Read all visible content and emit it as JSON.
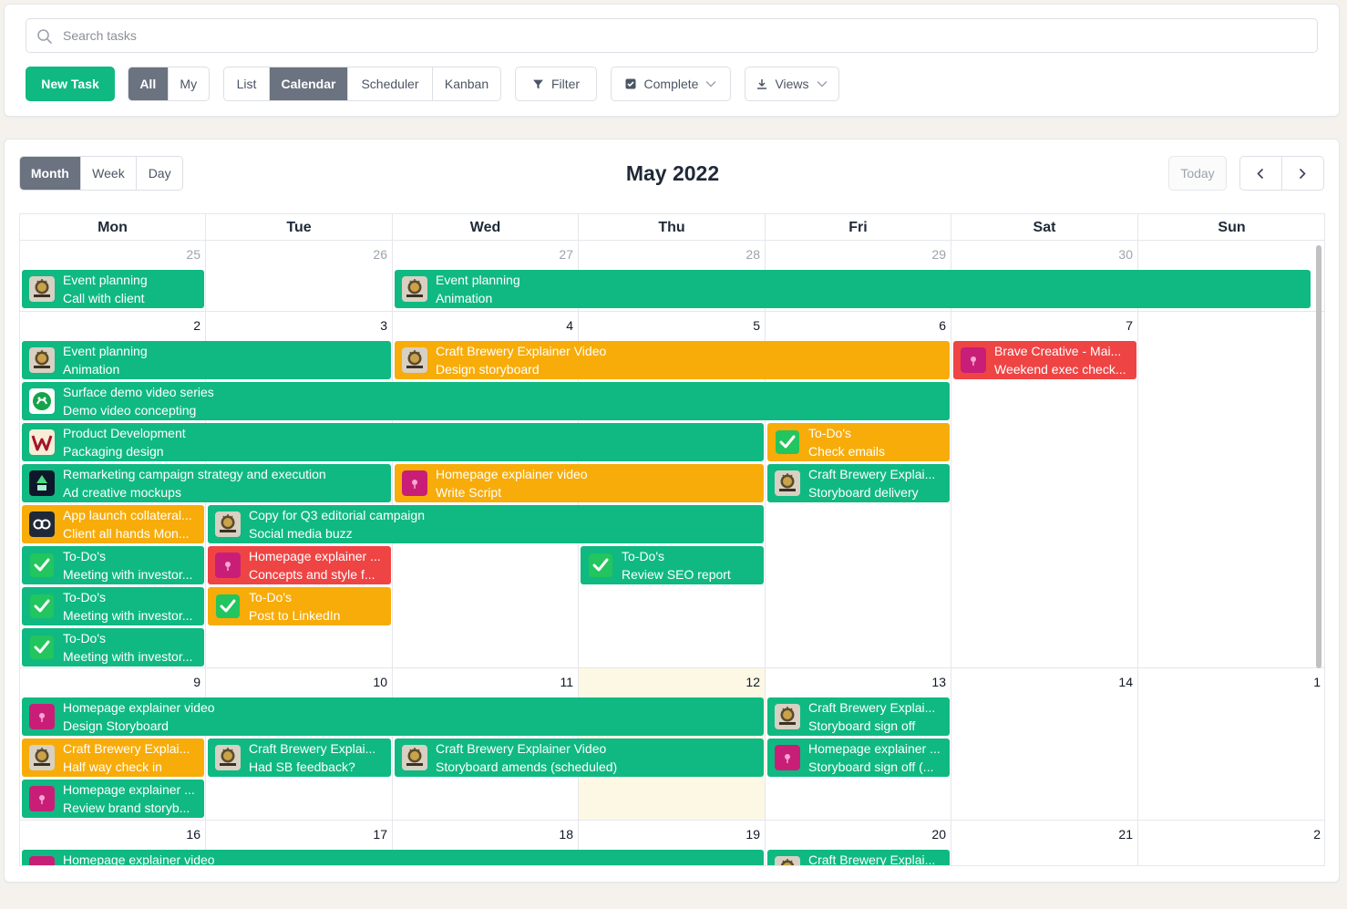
{
  "search": {
    "placeholder": "Search tasks",
    "value": ""
  },
  "toolbar": {
    "new_task": "New Task",
    "scope": [
      {
        "label": "All",
        "active": true
      },
      {
        "label": "My",
        "active": false
      }
    ],
    "views": [
      {
        "label": "List",
        "active": false
      },
      {
        "label": "Calendar",
        "active": true
      },
      {
        "label": "Scheduler",
        "active": false
      },
      {
        "label": "Kanban",
        "active": false
      }
    ],
    "filter": "Filter",
    "complete": "Complete",
    "views_menu": "Views"
  },
  "calendar": {
    "title": "May 2022",
    "range_tabs": [
      {
        "label": "Month",
        "active": true
      },
      {
        "label": "Week",
        "active": false
      },
      {
        "label": "Day",
        "active": false
      }
    ],
    "today": "Today",
    "weekdays": [
      "Mon",
      "Tue",
      "Wed",
      "Thu",
      "Fri",
      "Sat",
      "Sun"
    ],
    "weeks": [
      {
        "days": [
          {
            "n": "25",
            "other": true
          },
          {
            "n": "26",
            "other": true
          },
          {
            "n": "27",
            "other": true
          },
          {
            "n": "28",
            "other": true
          },
          {
            "n": "29",
            "other": true
          },
          {
            "n": "30",
            "other": true
          },
          {
            "n": "",
            "other": true
          }
        ],
        "events": [
          {
            "col": 0,
            "span": 1,
            "row": 0,
            "color": "green",
            "icon": "brewery",
            "t1": "Event planning",
            "t2": "Call with client"
          },
          {
            "col": 2,
            "span": 5,
            "row": 0,
            "color": "green",
            "icon": "brewery",
            "t1": "Event planning",
            "t2": "Animation"
          }
        ]
      },
      {
        "days": [
          {
            "n": "2"
          },
          {
            "n": "3"
          },
          {
            "n": "4"
          },
          {
            "n": "5"
          },
          {
            "n": "6"
          },
          {
            "n": "7"
          },
          {
            "n": ""
          }
        ],
        "events": [
          {
            "col": 0,
            "span": 2,
            "row": 0,
            "color": "green",
            "icon": "brewery",
            "t1": "Event planning",
            "t2": "Animation"
          },
          {
            "col": 2,
            "span": 3,
            "row": 0,
            "color": "orange",
            "icon": "brewery",
            "t1": "Craft Brewery Explainer Video",
            "t2": "Design storyboard"
          },
          {
            "col": 5,
            "span": 1,
            "row": 0,
            "color": "red",
            "icon": "chaos",
            "t1": "Brave Creative - Mai...",
            "t2": "Weekend exec check..."
          },
          {
            "col": 0,
            "span": 5,
            "row": 1,
            "color": "green",
            "icon": "surface",
            "t1": "Surface demo video series",
            "t2": "Demo video concepting"
          },
          {
            "col": 0,
            "span": 4,
            "row": 2,
            "color": "green",
            "icon": "w",
            "t1": "Product Development",
            "t2": "Packaging design"
          },
          {
            "col": 4,
            "span": 1,
            "row": 2,
            "color": "orange",
            "icon": "todo",
            "t1": "To-Do's",
            "t2": "Check emails"
          },
          {
            "col": 0,
            "span": 2,
            "row": 3,
            "color": "green",
            "icon": "remark",
            "t1": "Remarketing campaign strategy and execution",
            "t2": "Ad creative mockups"
          },
          {
            "col": 2,
            "span": 2,
            "row": 3,
            "color": "orange",
            "icon": "chaos",
            "t1": "Homepage explainer video",
            "t2": "Write Script"
          },
          {
            "col": 4,
            "span": 1,
            "row": 3,
            "color": "green",
            "icon": "brewery",
            "t1": "Craft Brewery Explai...",
            "t2": "Storyboard delivery"
          },
          {
            "col": 0,
            "span": 1,
            "row": 4,
            "color": "orange",
            "icon": "app",
            "t1": "App launch collateral...",
            "t2": "Client all hands Mon..."
          },
          {
            "col": 1,
            "span": 3,
            "row": 4,
            "color": "green",
            "icon": "brewery",
            "t1": "Copy for Q3 editorial campaign",
            "t2": "Social media buzz"
          },
          {
            "col": 0,
            "span": 1,
            "row": 5,
            "color": "green",
            "icon": "todo",
            "t1": "To-Do's",
            "t2": "Meeting with investor..."
          },
          {
            "col": 1,
            "span": 1,
            "row": 5,
            "color": "red",
            "icon": "chaos",
            "t1": "Homepage explainer ...",
            "t2": "Concepts and style f..."
          },
          {
            "col": 3,
            "span": 1,
            "row": 5,
            "color": "green",
            "icon": "todo",
            "t1": "To-Do's",
            "t2": "Review SEO report"
          },
          {
            "col": 0,
            "span": 1,
            "row": 6,
            "color": "green",
            "icon": "todo",
            "t1": "To-Do's",
            "t2": "Meeting with investor..."
          },
          {
            "col": 1,
            "span": 1,
            "row": 6,
            "color": "orange",
            "icon": "todo",
            "t1": "To-Do's",
            "t2": "Post to LinkedIn"
          },
          {
            "col": 0,
            "span": 1,
            "row": 7,
            "color": "green",
            "icon": "todo",
            "t1": "To-Do's",
            "t2": "Meeting with investor..."
          }
        ]
      },
      {
        "days": [
          {
            "n": "9"
          },
          {
            "n": "10"
          },
          {
            "n": "11"
          },
          {
            "n": "12",
            "today": true
          },
          {
            "n": "13"
          },
          {
            "n": "14"
          },
          {
            "n": "1"
          }
        ],
        "events": [
          {
            "col": 0,
            "span": 4,
            "row": 0,
            "color": "green",
            "icon": "chaos",
            "t1": "Homepage explainer video",
            "t2": "Design Storyboard"
          },
          {
            "col": 4,
            "span": 1,
            "row": 0,
            "color": "green",
            "icon": "brewery",
            "t1": "Craft Brewery Explai...",
            "t2": "Storyboard sign off"
          },
          {
            "col": 0,
            "span": 1,
            "row": 1,
            "color": "orange",
            "icon": "brewery",
            "t1": "Craft Brewery Explai...",
            "t2": "Half way check in"
          },
          {
            "col": 1,
            "span": 1,
            "row": 1,
            "color": "green",
            "icon": "brewery",
            "t1": "Craft Brewery Explai...",
            "t2": "Had SB feedback?"
          },
          {
            "col": 2,
            "span": 2,
            "row": 1,
            "color": "green",
            "icon": "brewery",
            "t1": "Craft Brewery Explainer Video",
            "t2": "Storyboard amends (scheduled)"
          },
          {
            "col": 4,
            "span": 1,
            "row": 1,
            "color": "green",
            "icon": "chaos",
            "t1": "Homepage explainer ...",
            "t2": "Storyboard sign off (..."
          },
          {
            "col": 0,
            "span": 1,
            "row": 2,
            "color": "green",
            "icon": "chaos",
            "t1": "Homepage explainer ...",
            "t2": "Review brand storyb..."
          }
        ]
      },
      {
        "days": [
          {
            "n": "16"
          },
          {
            "n": "17"
          },
          {
            "n": "18"
          },
          {
            "n": "19"
          },
          {
            "n": "20"
          },
          {
            "n": "21"
          },
          {
            "n": "2"
          }
        ],
        "events": [
          {
            "col": 0,
            "span": 4,
            "row": 0,
            "color": "green",
            "icon": "chaos",
            "t1": "Homepage explainer video",
            "t2": ""
          },
          {
            "col": 4,
            "span": 1,
            "row": 0,
            "color": "green",
            "icon": "brewery",
            "t1": "Craft Brewery Explai...",
            "t2": ""
          }
        ]
      }
    ]
  }
}
